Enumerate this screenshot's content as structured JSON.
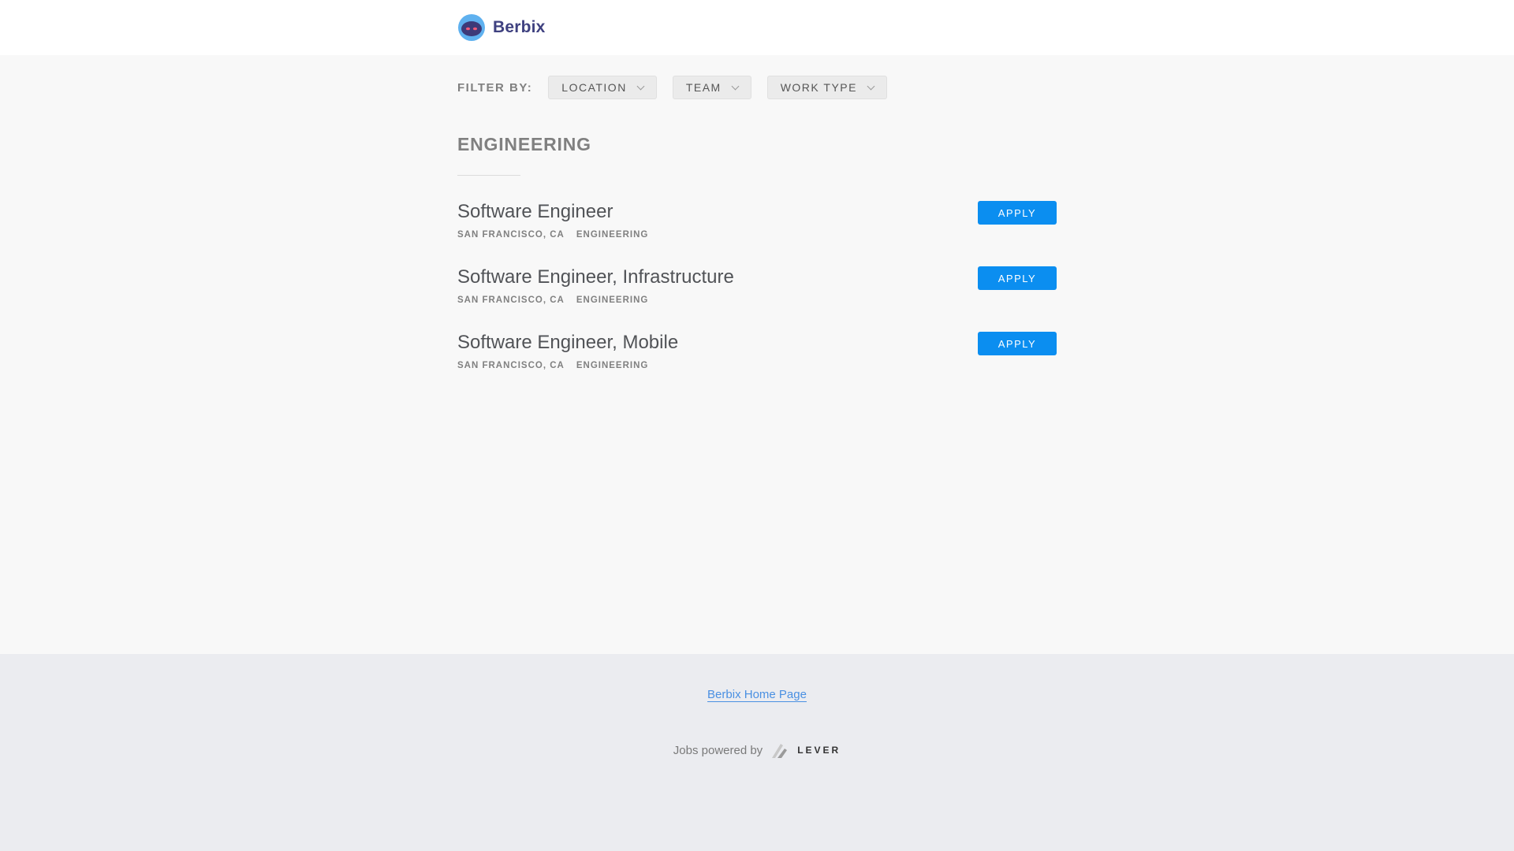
{
  "header": {
    "logo_text": "Berbix"
  },
  "filters": {
    "label": "FILTER BY:",
    "buttons": [
      {
        "label": "LOCATION"
      },
      {
        "label": "TEAM"
      },
      {
        "label": "WORK TYPE"
      }
    ]
  },
  "section": {
    "title": "ENGINEERING"
  },
  "postings": [
    {
      "title": "Software Engineer",
      "location": "SAN FRANCISCO, CA",
      "team": "ENGINEERING",
      "apply_label": "APPLY"
    },
    {
      "title": "Software Engineer, Infrastructure",
      "location": "SAN FRANCISCO, CA",
      "team": "ENGINEERING",
      "apply_label": "APPLY"
    },
    {
      "title": "Software Engineer, Mobile",
      "location": "SAN FRANCISCO, CA",
      "team": "ENGINEERING",
      "apply_label": "APPLY"
    }
  ],
  "footer": {
    "home_link": "Berbix Home Page",
    "powered_by": "Jobs powered by",
    "lever_wordmark": "LEVER"
  },
  "colors": {
    "apply_button": "#0b8ef0",
    "brand": "#3f4180",
    "link": "#4a90e2"
  },
  "icons": {
    "brand_logo": "berbix-logo-icon",
    "dropdown": "chevron-down-icon",
    "lever_logo": "lever-logo-icon"
  }
}
